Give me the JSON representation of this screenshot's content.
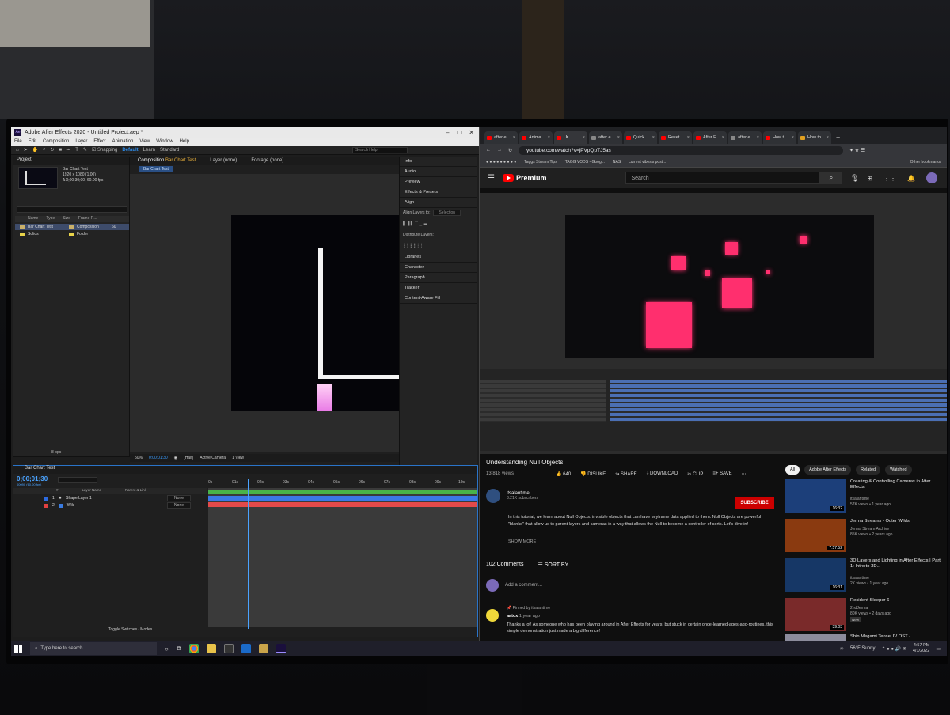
{
  "ae": {
    "title": "Adobe After Effects 2020 - Untitled Project.aep *",
    "menu": [
      "File",
      "Edit",
      "Composition",
      "Layer",
      "Effect",
      "Animation",
      "View",
      "Window",
      "Help"
    ],
    "snapping": "Snapping",
    "workspaces": [
      "Default",
      "Learn",
      "Standard"
    ],
    "search_help": "Search Help",
    "project": {
      "tab": "Project",
      "item_name": "Bar Chart Test",
      "item_size": "1920 x 1080 (1.00)",
      "item_duration": "Δ 0;00;30;00, 60.00 fps",
      "columns": [
        "Name",
        "Type",
        "Size",
        "Frame R..."
      ],
      "rows": [
        {
          "name": "Bar Chart Test",
          "type": "Composition",
          "rate": "60",
          "color": "#c9b06a"
        },
        {
          "name": "Solids",
          "type": "Folder",
          "rate": "",
          "color": "#e8d34a"
        }
      ],
      "bpc": "8 bpc"
    },
    "comp": {
      "tab": "Composition",
      "tab_name": "Bar Chart Test",
      "layer_tab": "Layer (none)",
      "footage_tab": "Footage (none)",
      "sub_tab": "Bar Chart Test",
      "zoom": "50%",
      "time": "0:00:01:30",
      "resolution": "(Half)",
      "camera": "Active Camera",
      "views": "1 View"
    },
    "right_panels": [
      "Info",
      "Audio",
      "Preview",
      "Effects & Presets",
      "Align"
    ],
    "align_layers_to": "Align Layers to:",
    "align_selection": "Selection",
    "distribute_layers": "Distribute Layers:",
    "right_panels_2": [
      "Libraries",
      "Character",
      "Paragraph",
      "Tracker",
      "Content-Aware Fill"
    ],
    "timeline": {
      "tab": "Bar Chart Test",
      "timecode": "0;00;01;30",
      "frames": "00090 (60.00 fps)",
      "columns": [
        "#",
        "Layer Name",
        "Parent & Link"
      ],
      "layers": [
        {
          "num": "1",
          "name": "Shape Layer 1",
          "parent": "None",
          "color": "#2d6be0"
        },
        {
          "num": "2",
          "name": "Wiki",
          "parent": "None",
          "color": "#e04040"
        }
      ],
      "ruler": [
        "0s",
        "01s",
        "02s",
        "03s",
        "04s",
        "05s",
        "06s",
        "07s",
        "08s",
        "09s",
        "10s"
      ],
      "footer": "Toggle Switches / Modes"
    }
  },
  "chrome": {
    "tabs": [
      "after e",
      "Anima",
      "Ur",
      "after e",
      "Quick",
      "Reset",
      "After E",
      "after e",
      "How t",
      "How to"
    ],
    "url": "youtube.com/watch?v=jPVpQpTJ5as",
    "bookmarks": [
      "Taggs Stream Tips",
      "TAGG VODS - Goog...",
      "NAS",
      "current vibes's post..."
    ],
    "other_bookmarks": "Other bookmarks"
  },
  "youtube": {
    "logo": "Premium",
    "search_placeholder": "Search",
    "title": "Understanding Null Objects",
    "views": "13,818 views",
    "likes": "640",
    "dislike": "DISLIKE",
    "share": "SHARE",
    "download": "DOWNLOAD",
    "clip": "CLIP",
    "save": "SAVE",
    "channel": "itsalantime",
    "subscribers": "3.21K subscribers",
    "subscribe": "SUBSCRIBE",
    "description": "In this tutorial, we learn about Null Objects: invisible objects that can have keyframe data applied to them. Null Objects are powerful \"blanks\" that allow us to parent layers and cameras in a way that allows the Null to become a controller of sorts. Let's dive in!",
    "show_more": "SHOW MORE",
    "comments_count": "102 Comments",
    "sort_by": "SORT BY",
    "add_comment": "Add a comment...",
    "pinned_label": "Pinned by itsalantime",
    "pinned_author": "aatox",
    "pinned_time": "1 year ago",
    "pinned_text": "Thanks a lot! As someone who has been playing around in After Effects for years, but stuck in certain once-learned-ages-ago-routines, this simple demonstration just made a big difference!",
    "chips": [
      "All",
      "Adobe After Effects",
      "Related",
      "Watched"
    ],
    "recommended": [
      {
        "title": "Creating & Controlling Cameras in After Effects",
        "channel": "itsalantime",
        "meta": "57K views • 1 year ago",
        "duration": "16:32",
        "thumb": "#1c3f7a"
      },
      {
        "title": "Jerma Streams - Outer Wilds",
        "channel": "Jerma Stream Archive",
        "meta": "85K views • 2 years ago",
        "duration": "7:57:52",
        "thumb": "#8a3a10"
      },
      {
        "title": "3D Layers and Lighting in After Effects | Part 1: Intro to 3D...",
        "channel": "itsalantime",
        "meta": "2K views • 1 year ago",
        "duration": "16:31",
        "thumb": "#163766"
      },
      {
        "title": "Resident Sleeper 6",
        "channel": "2ndJerma",
        "meta": "80K views • 2 days ago",
        "duration": "39:03",
        "badge": "New",
        "thumb": "#7a2a2a"
      },
      {
        "title": "Shin Megami Tensei IV OST -",
        "channel": "",
        "meta": "",
        "duration": "",
        "thumb": "#8c8c9c"
      }
    ]
  },
  "taskbar": {
    "search": "Type here to search",
    "weather": "56°F Sunny",
    "time": "4:57 PM",
    "date": "4/1/2022"
  }
}
